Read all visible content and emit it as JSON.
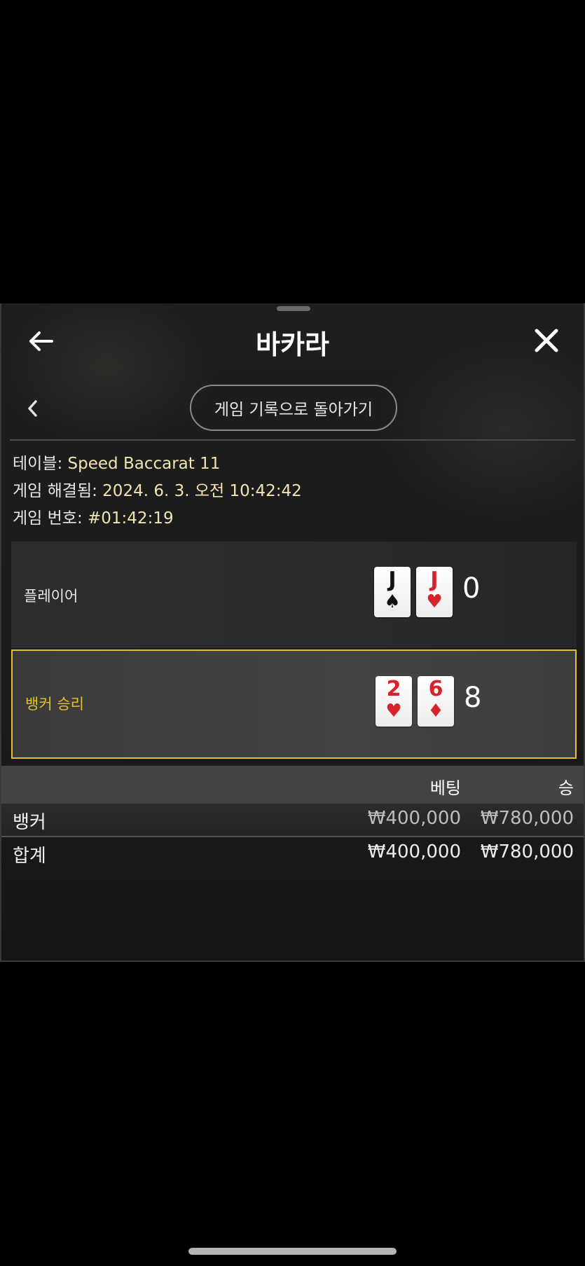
{
  "header": {
    "title": "바카라",
    "back_icon": "arrow-left-icon",
    "close_icon": "close-icon"
  },
  "nav": {
    "chevron_icon": "chevron-left-icon",
    "history_button_label": "게임 기록으로 돌아가기"
  },
  "info": {
    "table_label": "테이블: ",
    "table_value": "Speed Baccarat 11",
    "resolved_label": "게임 해결됨: ",
    "resolved_value": "2024. 6. 3. 오전 10:42:42",
    "number_label": "게임 번호: ",
    "number_value": "#01:42:19"
  },
  "hands": {
    "player": {
      "label": "플레이어",
      "cards": [
        {
          "rank": "J",
          "suit": "♠",
          "color": "black"
        },
        {
          "rank": "J",
          "suit": "♥",
          "color": "red"
        }
      ],
      "score": "0"
    },
    "banker": {
      "label": "뱅커 승리",
      "cards": [
        {
          "rank": "2",
          "suit": "♥",
          "color": "red"
        },
        {
          "rank": "6",
          "suit": "♦",
          "color": "red"
        }
      ],
      "score": "8"
    }
  },
  "bets": {
    "columns": [
      "베팅",
      "승"
    ],
    "rows": [
      {
        "name": "뱅커",
        "bet": "₩400,000",
        "win": "₩780,000"
      }
    ],
    "total": {
      "name": "합계",
      "bet": "₩400,000",
      "win": "₩780,000"
    }
  },
  "colors": {
    "accent_gold": "#e3c12a",
    "info_value": "#f2e3b0",
    "card_red": "#d8222a"
  }
}
